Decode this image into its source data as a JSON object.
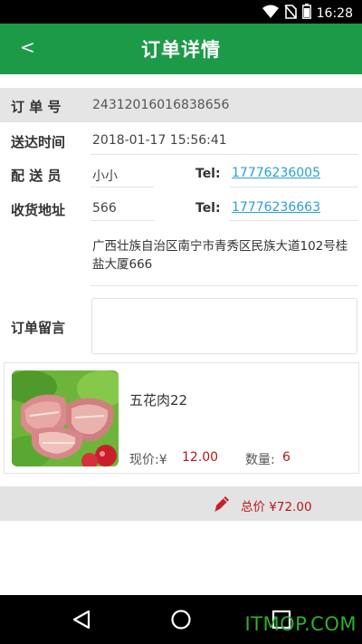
{
  "status_bar": {
    "time": "16:28",
    "icons": [
      "wifi-icon",
      "no-sim-icon",
      "battery-icon"
    ]
  },
  "header": {
    "back_label": "<",
    "title": "订单详情",
    "background_color": "#1c9a48"
  },
  "order": {
    "order_no_label": "订 单 号",
    "order_no": "24312016016838656",
    "delivery_time_label": "送达时间",
    "delivery_time": "2018-01-17 15:56:41",
    "courier_label": "配 送 员",
    "courier_name": "小小",
    "courier_tel_label": "Tel:",
    "courier_tel": "17776236005",
    "address_label": "收货地址",
    "receiver_name": "566",
    "receiver_tel_label": "Tel:",
    "receiver_tel": "17776236663",
    "address": "广西壮族自治区南宁市青秀区民族大道102号桂盐大厦666",
    "note_label": "订单留言",
    "note": ""
  },
  "product": {
    "name": "五花肉22",
    "price_label": "现价:¥",
    "price": "12.00",
    "qty_label": "数量:",
    "qty": "6"
  },
  "total": {
    "label": "总价 ¥72.00",
    "color": "#b8171c"
  },
  "watermark": "ITMOP.COM",
  "nav": [
    "back-icon",
    "home-icon",
    "recents-icon"
  ]
}
